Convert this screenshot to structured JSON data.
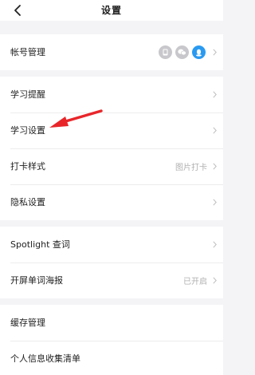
{
  "header": {
    "title": "设置"
  },
  "account_group": {
    "label": "帐号管理",
    "linked_accounts": [
      "phone-icon",
      "wechat-icon",
      "qq-icon"
    ]
  },
  "main_group": [
    {
      "label": "学习提醒",
      "value": ""
    },
    {
      "label": "学习设置",
      "value": ""
    },
    {
      "label": "打卡样式",
      "value": "图片打卡"
    },
    {
      "label": "隐私设置",
      "value": ""
    }
  ],
  "spotlight_group": [
    {
      "label": "Spotlight 查词",
      "value": ""
    },
    {
      "label": "开屏单词海报",
      "value": "已开启"
    }
  ],
  "misc_group": [
    {
      "label": "缓存管理"
    },
    {
      "label": "个人信息收集清单"
    }
  ],
  "colors": {
    "accent_arrow": "#e8262a",
    "qq_blue": "#2a9af1",
    "icon_grey": "#c8c8cc"
  }
}
